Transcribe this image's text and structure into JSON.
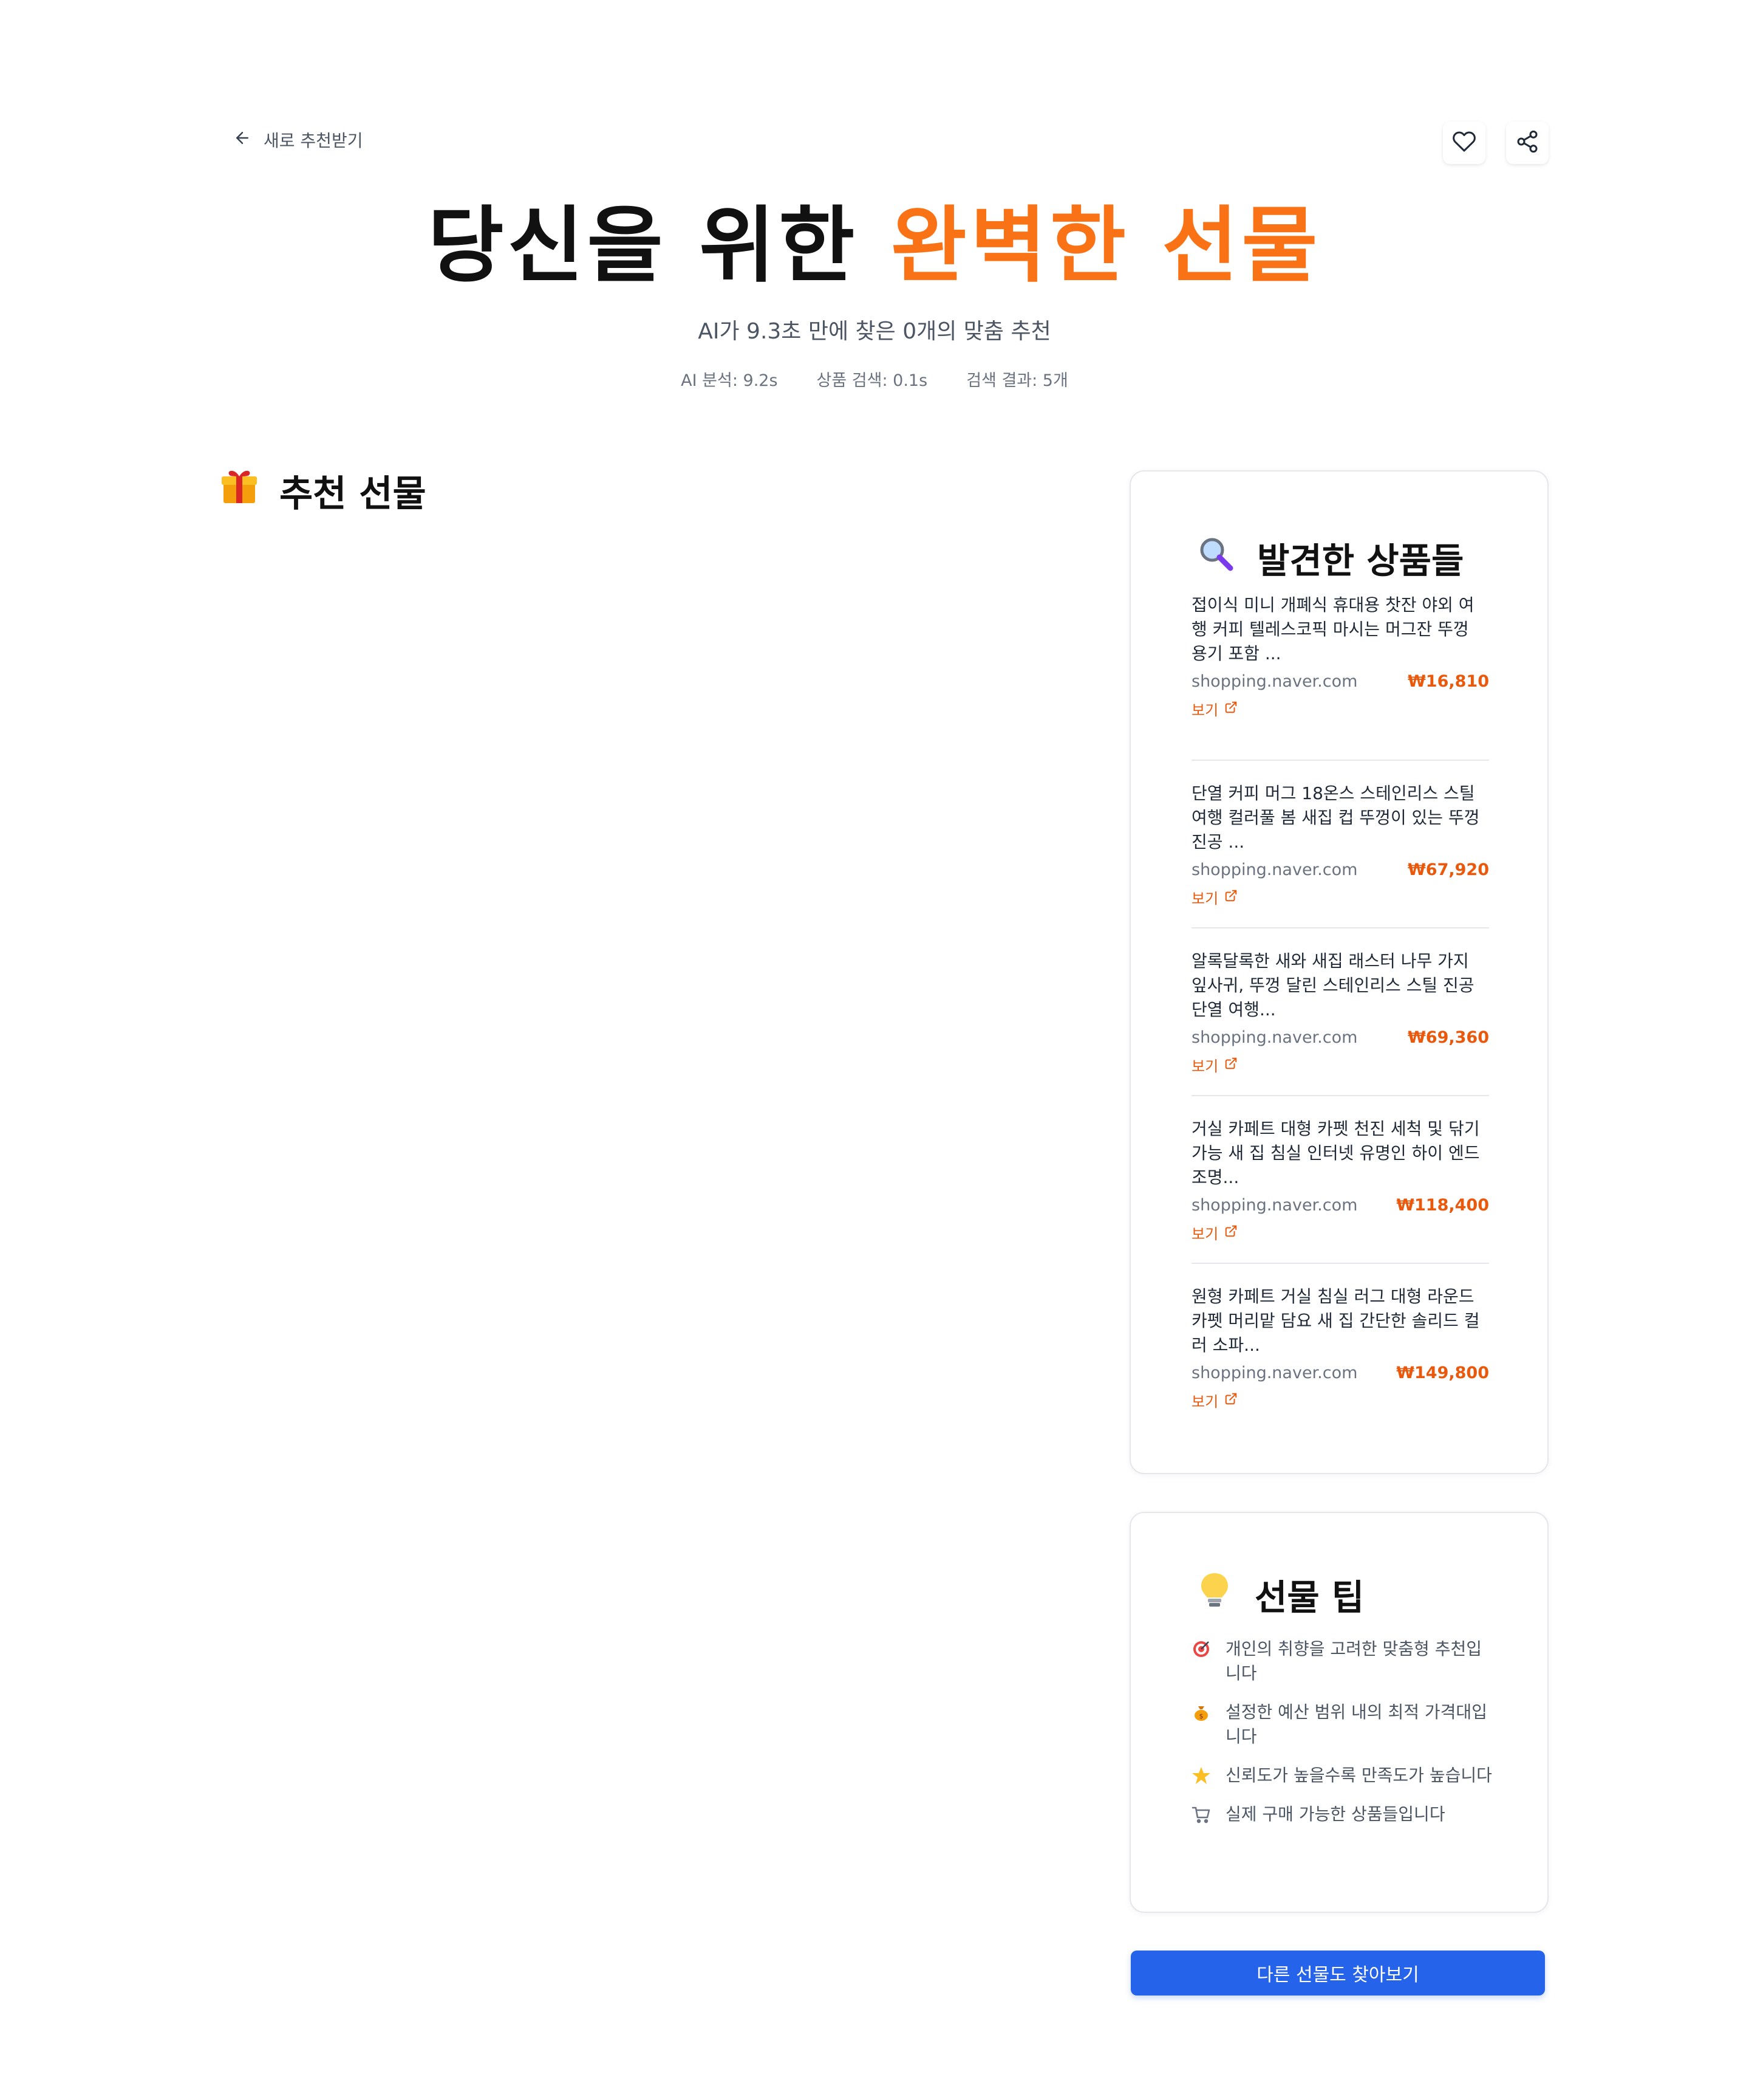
{
  "header": {
    "back_label": "새로 추천받기"
  },
  "hero": {
    "title_main": "당신을 위한 ",
    "title_accent": "완벽한 선물",
    "subtitle": "AI가 9.3초 만에 찾은 0개의 맞춤 추천",
    "stats": {
      "ai_analysis": "AI 분석: 9.2s",
      "product_search": "상품 검색: 0.1s",
      "search_results": "검색 결과: 5개"
    }
  },
  "recommendations": {
    "heading": "추천 선물",
    "icon": "gift-icon"
  },
  "found_products": {
    "heading": "발견한 상품들",
    "icon": "magnifier-icon",
    "view_label": "보기",
    "items": [
      {
        "title": "접이식 미니 개폐식 휴대용 찻잔 야외 여행 커피 텔레스코픽 마시는 머그잔 뚜껑 용기 포함 ...",
        "source": "shopping.naver.com",
        "price": "₩16,810"
      },
      {
        "title": "단열 커피 머그 18온스 스테인리스 스틸 여행 컬러풀 봄 새집 컵 뚜껑이 있는 뚜껑 진공 ...",
        "source": "shopping.naver.com",
        "price": "₩67,920"
      },
      {
        "title": "알록달록한 새와 새집 래스터 나무 가지 잎사귀, 뚜껑 달린 스테인리스 스틸 진공 단열 여행...",
        "source": "shopping.naver.com",
        "price": "₩69,360"
      },
      {
        "title": "거실 카페트 대형 카펫 천진 세척 및 닦기 가능 새 집 침실 인터넷 유명인 하이 엔드 조명...",
        "source": "shopping.naver.com",
        "price": "₩118,400"
      },
      {
        "title": "원형 카페트 거실 침실 러그 대형 라운드 카펫 머리맡 담요 새 집 간단한 솔리드 컬러 소파...",
        "source": "shopping.naver.com",
        "price": "₩149,800"
      }
    ]
  },
  "gift_tips": {
    "heading": "선물 팁",
    "icon": "lightbulb-icon",
    "items": [
      {
        "icon": "target-icon",
        "text": "개인의 취향을 고려한 맞춤형 추천입니다"
      },
      {
        "icon": "money-bag-icon",
        "text": "설정한 예산 범위 내의 최적 가격대입니다"
      },
      {
        "icon": "star-icon",
        "text": "신뢰도가 높을수록 만족도가 높습니다"
      },
      {
        "icon": "cart-icon",
        "text": "실제 구매 가능한 상품들입니다"
      }
    ]
  },
  "cta": {
    "label": "다른 선물도 찾아보기"
  },
  "colors": {
    "accent": "#f97316",
    "price": "#ea580c",
    "cta": "#2563eb"
  }
}
